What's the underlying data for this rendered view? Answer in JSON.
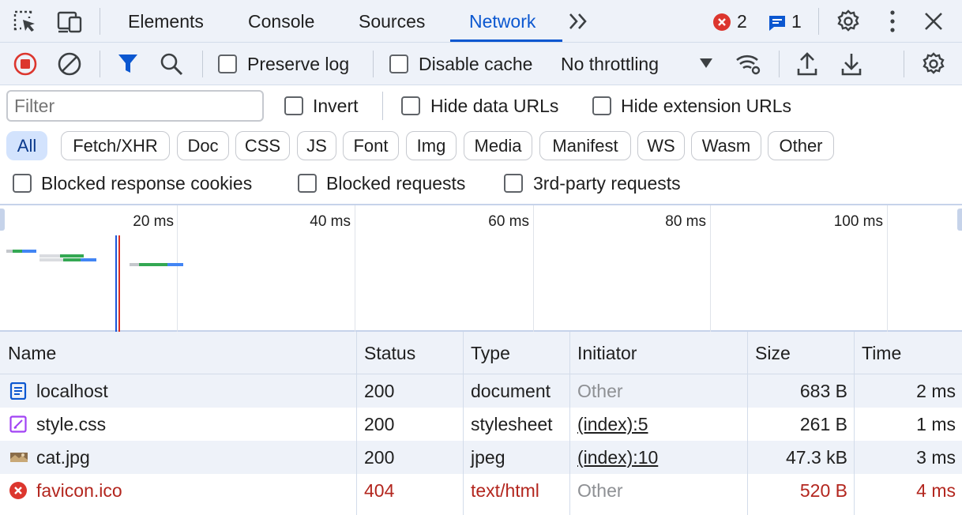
{
  "tabs": [
    {
      "label": "Elements"
    },
    {
      "label": "Console"
    },
    {
      "label": "Sources"
    },
    {
      "label": "Network"
    }
  ],
  "badges": {
    "errors": "2",
    "messages": "1"
  },
  "toolbar": {
    "preserve_log": "Preserve log",
    "disable_cache": "Disable cache",
    "throttling": "No throttling"
  },
  "filter": {
    "placeholder": "Filter",
    "invert": "Invert",
    "hide_data_urls": "Hide data URLs",
    "hide_extension_urls": "Hide extension URLs"
  },
  "chips": [
    "All",
    "Fetch/XHR",
    "Doc",
    "CSS",
    "JS",
    "Font",
    "Img",
    "Media",
    "Manifest",
    "WS",
    "Wasm",
    "Other"
  ],
  "checks": {
    "blocked_cookies": "Blocked response cookies",
    "blocked_requests": "Blocked requests",
    "third_party": "3rd-party requests"
  },
  "overview": {
    "ticks": [
      "20 ms",
      "40 ms",
      "60 ms",
      "80 ms",
      "100 ms"
    ]
  },
  "table": {
    "headers": {
      "name": "Name",
      "status": "Status",
      "type": "Type",
      "initiator": "Initiator",
      "size": "Size",
      "time": "Time"
    },
    "rows": [
      {
        "name": "localhost",
        "status": "200",
        "type": "document",
        "initiator": "Other",
        "size": "683 B",
        "time": "2 ms",
        "icon": "document-icon"
      },
      {
        "name": "style.css",
        "status": "200",
        "type": "stylesheet",
        "initiator": "(index):5",
        "size": "261 B",
        "time": "1 ms",
        "icon": "stylesheet-icon"
      },
      {
        "name": "cat.jpg",
        "status": "200",
        "type": "jpeg",
        "initiator": "(index):10",
        "size": "47.3 kB",
        "time": "3 ms",
        "icon": "image-thumbnail-icon"
      },
      {
        "name": "favicon.ico",
        "status": "404",
        "type": "text/html",
        "initiator": "Other",
        "size": "520 B",
        "time": "4 ms",
        "icon": "error-icon"
      }
    ]
  },
  "colors": {
    "accent": "#0b57d0",
    "error": "#b3261e",
    "toolbar_bg": "#eef2f9"
  }
}
